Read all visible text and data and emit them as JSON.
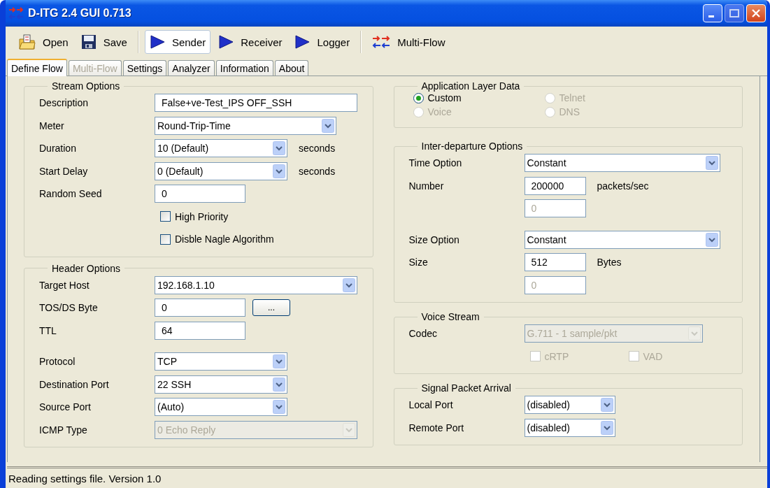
{
  "window": {
    "title": "D-ITG 2.4 GUI 0.713"
  },
  "toolbar": {
    "groups": [
      [
        {
          "label": "Open",
          "pressed": false
        },
        {
          "label": "Save",
          "pressed": false
        }
      ],
      [
        {
          "label": "Sender",
          "pressed": true
        },
        {
          "label": "Receiver",
          "pressed": false
        },
        {
          "label": "Logger",
          "pressed": false
        }
      ],
      [
        {
          "label": "Multi-Flow",
          "pressed": false
        }
      ]
    ]
  },
  "tabs": [
    {
      "label": "Define Flow",
      "selected": true,
      "disabled": false
    },
    {
      "label": "Multi-Flow",
      "selected": false,
      "disabled": true
    },
    {
      "label": "Settings",
      "selected": false,
      "disabled": false
    },
    {
      "label": "Analyzer",
      "selected": false,
      "disabled": false
    },
    {
      "label": "Information",
      "selected": false,
      "disabled": false
    },
    {
      "label": "About",
      "selected": false,
      "disabled": false
    }
  ],
  "panels": [
    {
      "groups": [
        {
          "title": "Stream Options",
          "rows": [
            {
              "kind": "text",
              "label": "Description",
              "value": "False+ve-Test_IPS OFF_SSH",
              "disabled": false
            },
            {
              "kind": "combo",
              "label": "Meter",
              "value": "Round-Trip-Time",
              "disabled": false
            },
            {
              "kind": "combo",
              "label": "Duration",
              "value": "10 (Default)",
              "unit": "seconds",
              "disabled": false
            },
            {
              "kind": "combo",
              "label": "Start Delay",
              "value": "0 (Default)",
              "unit": "seconds",
              "disabled": false
            },
            {
              "kind": "text",
              "label": "Random Seed",
              "value": "0",
              "disabled": false
            },
            {
              "kind": "checkbox",
              "text": "High Priority",
              "checked": false,
              "disabled": false
            },
            {
              "kind": "checkbox",
              "text": "Disble Nagle Algorithm",
              "checked": false,
              "disabled": false
            }
          ]
        },
        {
          "title": "Header Options",
          "rows": [
            {
              "kind": "combo",
              "label": "Target Host",
              "value": "192.168.1.10",
              "disabled": false
            },
            {
              "kind": "text",
              "label": "TOS/DS Byte",
              "value": "0",
              "button": "...",
              "disabled": false
            },
            {
              "kind": "text",
              "label": "TTL",
              "value": "64",
              "disabled": false
            },
            {
              "kind": "combo",
              "label": "Protocol",
              "value": "TCP",
              "disabled": false
            },
            {
              "kind": "combo",
              "label": "Destination Port",
              "value": "22 SSH",
              "disabled": false
            },
            {
              "kind": "combo",
              "label": "Source Port",
              "value": "(Auto)",
              "disabled": false
            },
            {
              "kind": "combo",
              "label": "ICMP Type",
              "value": "0 Echo Reply",
              "disabled": true
            }
          ]
        }
      ]
    },
    {
      "groups": [
        {
          "title": "Application Layer Data",
          "rows": [
            {
              "kind": "radios",
              "options": [
                {
                  "label": "Custom",
                  "selected": true,
                  "disabled": false
                },
                {
                  "label": "Telnet",
                  "selected": false,
                  "disabled": true
                },
                {
                  "label": "Voice",
                  "selected": false,
                  "disabled": true
                },
                {
                  "label": "DNS",
                  "selected": false,
                  "disabled": true
                }
              ]
            }
          ]
        },
        {
          "title": "Inter-departure Options",
          "rows": [
            {
              "kind": "combo",
              "label": "Time Option",
              "value": "Constant",
              "disabled": false
            },
            {
              "kind": "text",
              "label": "Number",
              "value": "200000",
              "unit": "packets/sec",
              "disabled": false
            },
            {
              "kind": "text",
              "value": "0",
              "disabled": true
            },
            {
              "kind": "combo",
              "label": "Size Option",
              "value": "Constant",
              "disabled": false
            },
            {
              "kind": "text",
              "label": "Size",
              "value": "512",
              "unit": "Bytes",
              "disabled": false
            },
            {
              "kind": "text",
              "value": "0",
              "disabled": true
            }
          ]
        },
        {
          "title": "Voice Stream",
          "rows": [
            {
              "kind": "combo",
              "label": "Codec",
              "value": "G.711 - 1 sample/pkt",
              "disabled": true
            },
            {
              "kind": "checks",
              "options": [
                {
                  "label": "cRTP",
                  "checked": false,
                  "disabled": true
                },
                {
                  "label": "VAD",
                  "checked": false,
                  "disabled": true
                }
              ]
            }
          ]
        },
        {
          "title": "Signal Packet Arrival",
          "rows": [
            {
              "kind": "combo",
              "label": "Local Port",
              "value": "(disabled)",
              "disabled": false
            },
            {
              "kind": "combo",
              "label": "Remote Port",
              "value": "(disabled)",
              "disabled": false
            }
          ]
        }
      ]
    }
  ],
  "status_bar": {
    "text": "Reading settings file. Version 1.0"
  }
}
